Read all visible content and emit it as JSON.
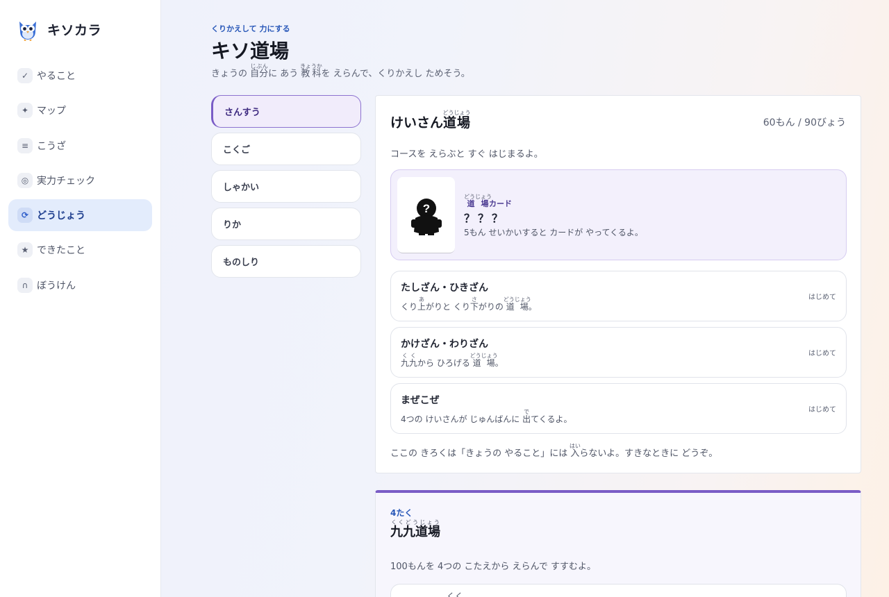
{
  "app": {
    "name": "キソカラ"
  },
  "sidebar": {
    "items": [
      {
        "label": "やること",
        "icon": "check-icon",
        "glyph": "✓",
        "active": false
      },
      {
        "label": "マップ",
        "icon": "sparkle-icon",
        "glyph": "✦",
        "active": false
      },
      {
        "label": "こうざ",
        "icon": "menu-icon",
        "glyph": "≡",
        "active": false
      },
      {
        "label": "実力チェック",
        "icon": "target-icon",
        "glyph": "◎",
        "active": false
      },
      {
        "label": "どうじょう",
        "icon": "refresh-icon",
        "glyph": "⟳",
        "active": true
      },
      {
        "label": "できたこと",
        "icon": "star-icon",
        "glyph": "★",
        "active": false
      },
      {
        "label": "ぼうけん",
        "icon": "arch-icon",
        "glyph": "∩",
        "active": false
      }
    ]
  },
  "header": {
    "eyebrow": "くりかえして 力にする",
    "title": "キソ道場",
    "subtitle_parts": [
      "きょうの ",
      "自分",
      "じぶん",
      "に あう ",
      "教科",
      "きょうか",
      "を えらんで、くりかえし ためそう。"
    ]
  },
  "subjects": [
    {
      "label": "さんすう",
      "active": true
    },
    {
      "label": "こくご",
      "active": false
    },
    {
      "label": "しゃかい",
      "active": false
    },
    {
      "label": "りか",
      "active": false
    },
    {
      "label": "ものしり",
      "active": false
    }
  ],
  "dojo": {
    "title_prefix": "けいさん",
    "title_kanji": "道場",
    "title_ruby": "どうじょう",
    "meta": "60もん / 90びょう",
    "description": "コースを えらぶと すぐ はじまるよ。",
    "card": {
      "label_kanji": "道場",
      "label_ruby": "どうじょう",
      "label_suffix": "カード",
      "name": "？？？",
      "note": "5もん せいかいすると カードが やってくるよ。"
    },
    "courses": [
      {
        "name": "たしざん・ひきざん",
        "desc_parts": [
          "くり",
          "上",
          "あ",
          "がりと くり",
          "下",
          "さ",
          "がりの ",
          "道場",
          "どうじょう",
          "。"
        ],
        "status": "はじめて"
      },
      {
        "name": "かけざん・わりざん",
        "desc_parts": [
          "",
          "九九",
          "くく",
          "から ひろげる ",
          "道場",
          "どうじょう",
          "。"
        ],
        "status": "はじめて"
      },
      {
        "name": "まぜこぜ",
        "desc_parts": [
          "4つの けいさんが じゅんばんに ",
          "出",
          "で",
          "てくるよ。"
        ],
        "status": "はじめて"
      }
    ],
    "note_parts": [
      "ここの きろくは「きょうの やること」には ",
      "入",
      "はい",
      "らないよ。すきなときに どうぞ。"
    ]
  },
  "kuku": {
    "tag": "4たく",
    "title_kanji": "九九道場",
    "title_ruby": "くくどうじょう",
    "description": "100もんを 4つの こたえから えらんで すすむよ。",
    "row_ruby": "くく"
  },
  "colors": {
    "accent_blue": "#2857b8",
    "accent_purple": "#7a5cc6",
    "active_nav_bg": "#e3ecfc"
  }
}
